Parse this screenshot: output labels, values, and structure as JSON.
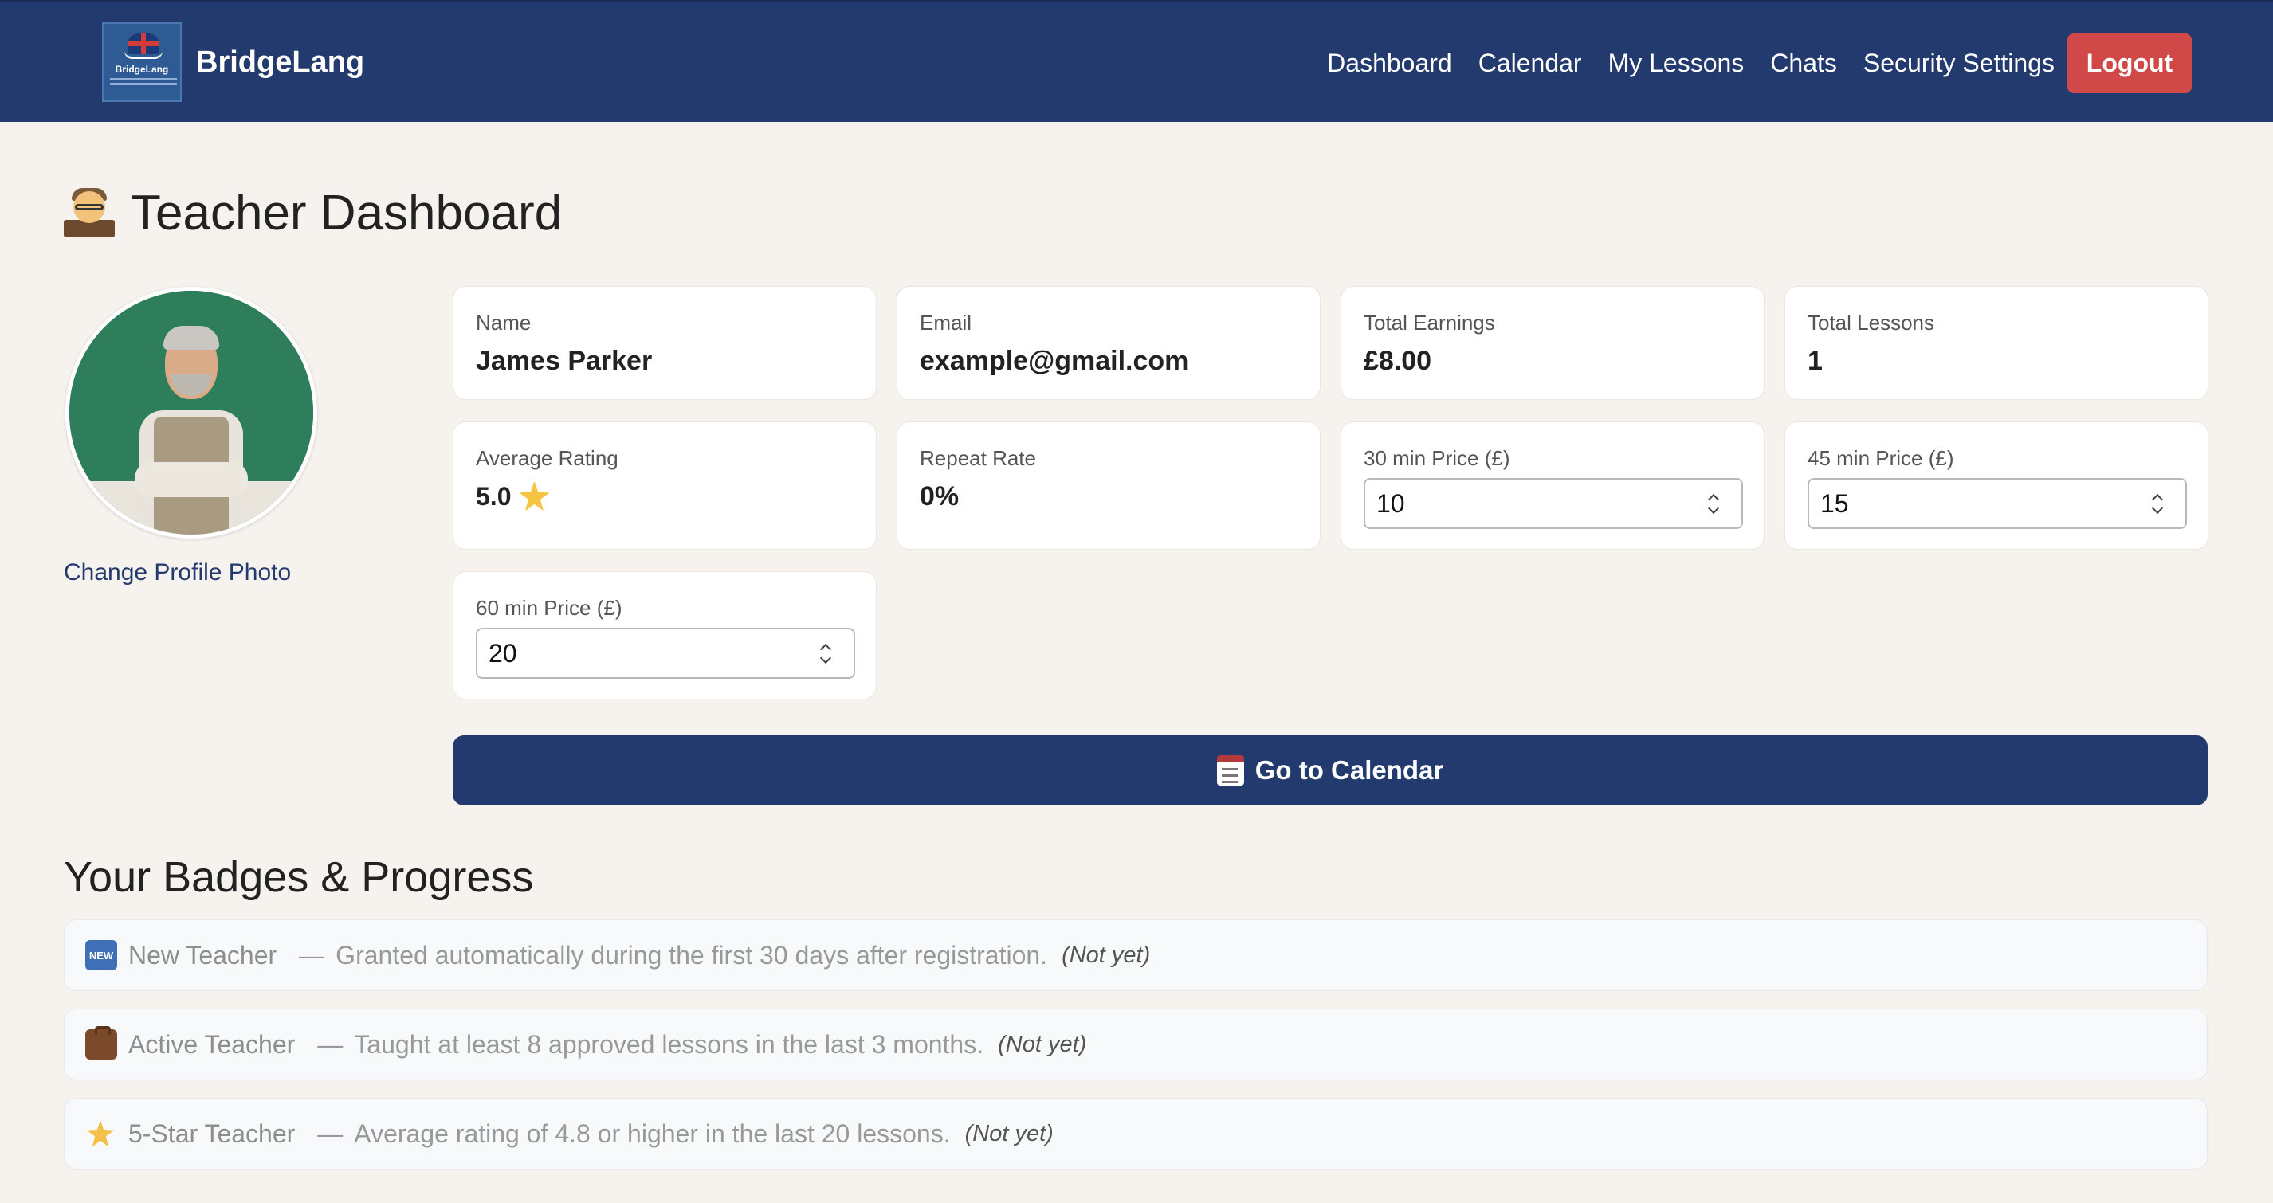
{
  "nav": {
    "brand": "BridgeLang",
    "logo_text": "BridgeLang",
    "links": [
      "Dashboard",
      "Calendar",
      "My Lessons",
      "Chats",
      "Security Settings"
    ],
    "logout": "Logout"
  },
  "page": {
    "title": "Teacher Dashboard",
    "change_photo": "Change Profile Photo"
  },
  "stats": {
    "name": {
      "label": "Name",
      "value": "James Parker"
    },
    "email": {
      "label": "Email",
      "value": "example@gmail.com"
    },
    "earnings": {
      "label": "Total Earnings",
      "value": "£8.00"
    },
    "lessons": {
      "label": "Total Lessons",
      "value": "1"
    },
    "rating": {
      "label": "Average Rating",
      "value": "5.0"
    },
    "repeat": {
      "label": "Repeat Rate",
      "value": "0%"
    },
    "price30": {
      "label": "30 min Price (£)",
      "value": "10"
    },
    "price45": {
      "label": "45 min Price (£)",
      "value": "15"
    },
    "price60": {
      "label": "60 min Price (£)",
      "value": "20"
    }
  },
  "calendar_button": "Go to Calendar",
  "badges": {
    "title": "Your Badges & Progress",
    "items": [
      {
        "icon": "new-icon",
        "icon_text": "NEW",
        "name": "New Teacher",
        "desc": "Granted automatically during the first 30 days after registration.",
        "status": "(Not yet)"
      },
      {
        "icon": "briefcase-icon",
        "name": "Active Teacher",
        "desc": "Taught at least 8 approved lessons in the last 3 months.",
        "status": "(Not yet)"
      },
      {
        "icon": "glowing-star-icon",
        "name": "5-Star Teacher",
        "desc": "Average rating of 4.8 or higher in the last 20 lessons.",
        "status": "(Not yet)"
      }
    ]
  },
  "colors": {
    "navbar": "#233a6e",
    "logout": "#d04848",
    "background": "#f6f3ef"
  }
}
